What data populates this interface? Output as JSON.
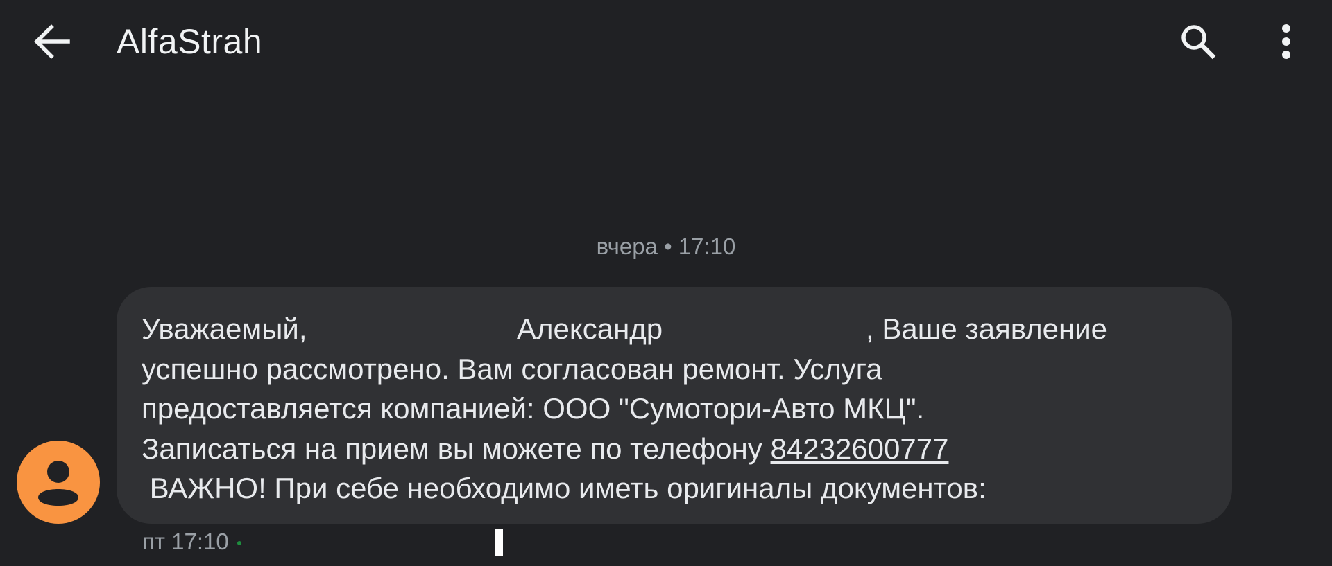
{
  "appbar": {
    "title": "AlfaStrah",
    "back_icon": "arrow-left-icon",
    "search_icon": "search-icon",
    "more_icon": "more-vert-icon"
  },
  "conversation": {
    "date_divider": "вчера • 17:10",
    "message": {
      "line1_a": "Уважаемый,",
      "line1_b": "Александр",
      "line1_c": ", Ваше заявление",
      "line2": "успешно рассмотрено. Вам согласован ремонт. Услуга",
      "line3": "предоставляется компанией: ООО \"Сумотори-Авто МКЦ\".",
      "line4_text": "Записаться на прием вы можете по телефону ",
      "phone": "84232600777",
      "line5": " ВАЖНО! При себе необходимо иметь оригиналы документов:"
    },
    "meta_time": "пт 17:10",
    "avatar_icon": "person-icon"
  },
  "colors": {
    "background": "#202124",
    "bubble": "#303134",
    "avatar": "#f99441",
    "text_primary": "#e8eaed",
    "text_secondary": "#9aa0a6",
    "status_dot": "#1e8e3e"
  }
}
